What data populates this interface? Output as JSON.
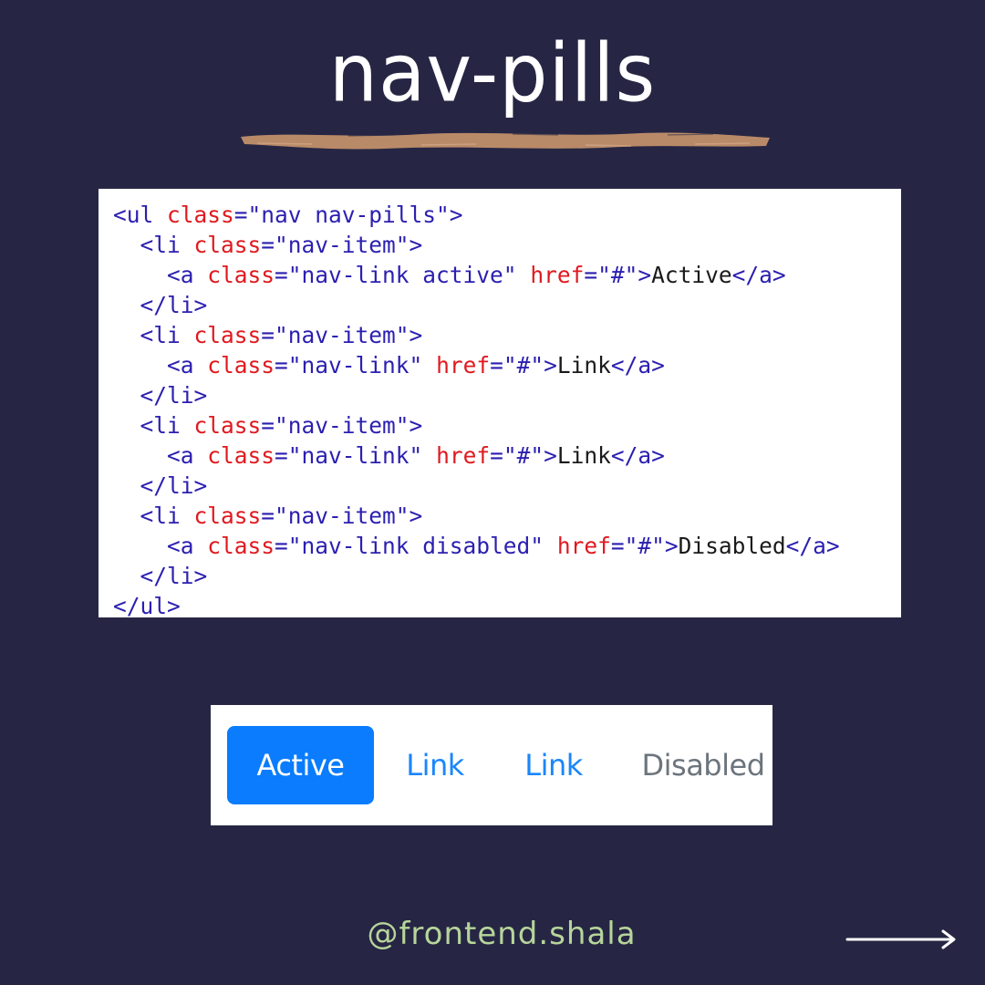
{
  "title": "nav-pills",
  "code": {
    "lines": [
      [
        [
          "tg",
          "<ul "
        ],
        [
          "an",
          "class"
        ],
        [
          "tg",
          "=\"nav nav-pills\">"
        ]
      ],
      [
        [
          "tx",
          "  "
        ],
        [
          "tg",
          "<li "
        ],
        [
          "an",
          "class"
        ],
        [
          "tg",
          "=\"nav-item\">"
        ]
      ],
      [
        [
          "tx",
          "    "
        ],
        [
          "tg",
          "<a "
        ],
        [
          "an",
          "class"
        ],
        [
          "tg",
          "=\"nav-link active\" "
        ],
        [
          "an",
          "href"
        ],
        [
          "tg",
          "=\"#\">"
        ],
        [
          "tx",
          "Active"
        ],
        [
          "tg",
          "</a>"
        ]
      ],
      [
        [
          "tx",
          "  "
        ],
        [
          "tg",
          "</li>"
        ]
      ],
      [
        [
          "tx",
          "  "
        ],
        [
          "tg",
          "<li "
        ],
        [
          "an",
          "class"
        ],
        [
          "tg",
          "=\"nav-item\">"
        ]
      ],
      [
        [
          "tx",
          "    "
        ],
        [
          "tg",
          "<a "
        ],
        [
          "an",
          "class"
        ],
        [
          "tg",
          "=\"nav-link\" "
        ],
        [
          "an",
          "href"
        ],
        [
          "tg",
          "=\"#\">"
        ],
        [
          "tx",
          "Link"
        ],
        [
          "tg",
          "</a>"
        ]
      ],
      [
        [
          "tx",
          "  "
        ],
        [
          "tg",
          "</li>"
        ]
      ],
      [
        [
          "tx",
          "  "
        ],
        [
          "tg",
          "<li "
        ],
        [
          "an",
          "class"
        ],
        [
          "tg",
          "=\"nav-item\">"
        ]
      ],
      [
        [
          "tx",
          "    "
        ],
        [
          "tg",
          "<a "
        ],
        [
          "an",
          "class"
        ],
        [
          "tg",
          "=\"nav-link\" "
        ],
        [
          "an",
          "href"
        ],
        [
          "tg",
          "=\"#\">"
        ],
        [
          "tx",
          "Link"
        ],
        [
          "tg",
          "</a>"
        ]
      ],
      [
        [
          "tx",
          "  "
        ],
        [
          "tg",
          "</li>"
        ]
      ],
      [
        [
          "tx",
          "  "
        ],
        [
          "tg",
          "<li "
        ],
        [
          "an",
          "class"
        ],
        [
          "tg",
          "=\"nav-item\">"
        ]
      ],
      [
        [
          "tx",
          "    "
        ],
        [
          "tg",
          "<a "
        ],
        [
          "an",
          "class"
        ],
        [
          "tg",
          "=\"nav-link disabled\" "
        ],
        [
          "an",
          "href"
        ],
        [
          "tg",
          "=\"#\">"
        ],
        [
          "tx",
          "Disabled"
        ],
        [
          "tg",
          "</a>"
        ]
      ],
      [
        [
          "tx",
          "  "
        ],
        [
          "tg",
          "</li>"
        ]
      ],
      [
        [
          "tg",
          "</ul>"
        ]
      ]
    ]
  },
  "preview": {
    "active_label": "Active",
    "link1_label": "Link",
    "link2_label": "Link",
    "disabled_label": "Disabled"
  },
  "footer": {
    "handle": "@frontend.shala",
    "arrow_icon": "right-arrow-icon"
  },
  "colors": {
    "background": "#262644",
    "brush_stroke": "#b98a68",
    "active_pill": "#0a7cfd",
    "link": "#1a86fc",
    "disabled": "#6c757d",
    "handle": "#b7d59a",
    "code_tag": "#2b1fb0",
    "code_attr": "#e0191f"
  }
}
